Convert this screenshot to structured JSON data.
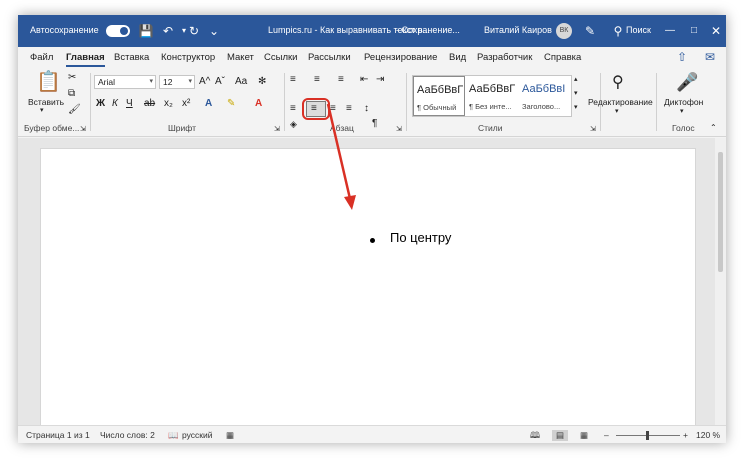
{
  "titlebar": {
    "autosave_label": "Автосохранение",
    "doc_title": "Lumpics.ru - Как выравнивать текст в...",
    "save_status": "-  Сохранение...",
    "user_name": "Виталий Каиров",
    "user_initials": "ВК",
    "search_label": "Поиск"
  },
  "menu": {
    "tabs": [
      "Файл",
      "Главная",
      "Вставка",
      "Конструктор",
      "Макет",
      "Ссылки",
      "Рассылки",
      "Рецензирование",
      "Вид",
      "Разработчик",
      "Справка"
    ]
  },
  "ribbon": {
    "paste_label": "Вставить",
    "font_name": "Arial",
    "font_size": "12",
    "groups": {
      "clipboard": "Буфер обме...",
      "font": "Шрифт",
      "paragraph": "Абзац",
      "styles": "Стили",
      "voice": "Голос"
    },
    "font_buttons": [
      "Ж",
      "К",
      "Ч",
      "ab",
      "x₂",
      "x²"
    ],
    "grow_font": "A^",
    "shrink_font": "Aˇ",
    "case_button": "Aa",
    "styles": [
      {
        "preview": "АаБбВвГ",
        "name": "¶ Обычный"
      },
      {
        "preview": "АаБбВвГ",
        "name": "¶ Без инте..."
      },
      {
        "preview": "АаБбВвI",
        "name": "Заголово..."
      }
    ],
    "editing_label": "Редактирование",
    "dictate_label": "Диктофон"
  },
  "document": {
    "bullet_text": "По центру"
  },
  "status": {
    "page": "Страница 1 из 1",
    "words": "Число слов: 2",
    "language": "русский",
    "zoom_minus": "–",
    "zoom_plus": "+",
    "zoom": "120 %"
  },
  "colors": {
    "accent": "#2b579a",
    "highlight_arrow": "#d93025"
  }
}
